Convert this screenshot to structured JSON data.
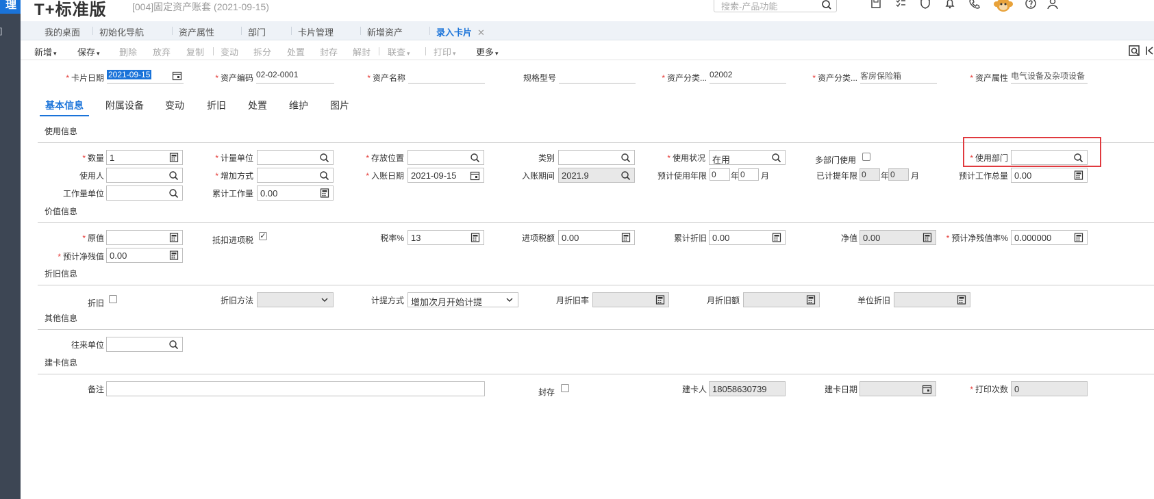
{
  "header": {
    "brand": "T+标准版",
    "subtitle": "[004]固定资产账套  (2021-09-15)",
    "search_placeholder": "搜索-产品功能"
  },
  "tabs": [
    {
      "label": "我的桌面"
    },
    {
      "label": "初始化导航"
    },
    {
      "label": "资产属性"
    },
    {
      "label": "部门"
    },
    {
      "label": "卡片管理"
    },
    {
      "label": "新增资产"
    },
    {
      "label": "录入卡片",
      "close": "✕"
    }
  ],
  "toolbar": {
    "new": "新增",
    "save": "保存",
    "delete": "删除",
    "discard": "放弃",
    "copy": "复制",
    "change": "变动",
    "split": "拆分",
    "dispose": "处置",
    "seal": "封存",
    "unseal": "解封",
    "query": "联查",
    "print": "打印",
    "more": "更多"
  },
  "card_header": {
    "date_label": "卡片日期",
    "date_value": "2021-09-15",
    "code_label": "资产编码",
    "code_value": "02-02-0001",
    "name_label": "资产名称",
    "name_value": "",
    "spec_label": "规格型号",
    "spec_value": "",
    "category_code_label": "资产分类...",
    "category_code_value": "02002",
    "category_name_label": "资产分类...",
    "category_name_value": "客房保险箱",
    "attr_label": "资产属性",
    "attr_value": "电气设备及杂项设备"
  },
  "subtabs": [
    "基本信息",
    "附属设备",
    "变动",
    "折旧",
    "处置",
    "维护",
    "图片"
  ],
  "sections": {
    "usage": "使用信息",
    "value": "价值信息",
    "depreciation": "折旧信息",
    "other": "其他信息",
    "card": "建卡信息"
  },
  "usage": {
    "qty_label": "数量",
    "qty_value": "1",
    "unit_label": "计量单位",
    "location_label": "存放位置",
    "type_label": "类别",
    "status_label": "使用状况",
    "status_value": "在用",
    "multi_dept_label": "多部门使用",
    "dept_label": "使用部门",
    "user_label": "使用人",
    "add_method_label": "增加方式",
    "entry_date_label": "入账日期",
    "entry_date_value": "2021-09-15",
    "entry_period_label": "入账期间",
    "entry_period_value": "2021.9",
    "life_label": "预计使用年限",
    "life_year": "0",
    "year_unit": "年",
    "life_month": "0",
    "month_unit": "月",
    "accrued_label": "已计提年限",
    "accrued_year": "0",
    "accrued_month": "0",
    "total_work_label": "预计工作总量",
    "total_work_value": "0.00",
    "work_unit_label": "工作量单位",
    "acc_work_label": "累计工作量",
    "acc_work_value": "0.00"
  },
  "value": {
    "original_label": "原值",
    "deduct_label": "抵扣进项税",
    "tax_rate_label": "税率%",
    "tax_rate_value": "13",
    "input_tax_label": "进项税额",
    "input_tax_value": "0.00",
    "acc_dep_label": "累计折旧",
    "acc_dep_value": "0.00",
    "net_label": "净值",
    "net_value": "0.00",
    "residual_rate_label": "预计净残值率%",
    "residual_rate_value": "0.000000",
    "residual_label": "预计净残值",
    "residual_value": "0.00"
  },
  "depreciation": {
    "dep_label": "折旧",
    "method_label": "折旧方法",
    "accrual_label": "计提方式",
    "accrual_value": "增加次月开始计提",
    "monthly_rate_label": "月折旧率",
    "monthly_amount_label": "月折旧额",
    "unit_dep_label": "单位折旧"
  },
  "other": {
    "partner_label": "往来单位"
  },
  "card": {
    "remark_label": "备注",
    "sealed_label": "封存",
    "creator_label": "建卡人",
    "creator_value": "18058630739",
    "create_date_label": "建卡日期",
    "print_count_label": "打印次数",
    "print_count_value": "0"
  },
  "accent": "#1a73d9",
  "required_color": "#e53935",
  "highlight_color": "#e0393e"
}
